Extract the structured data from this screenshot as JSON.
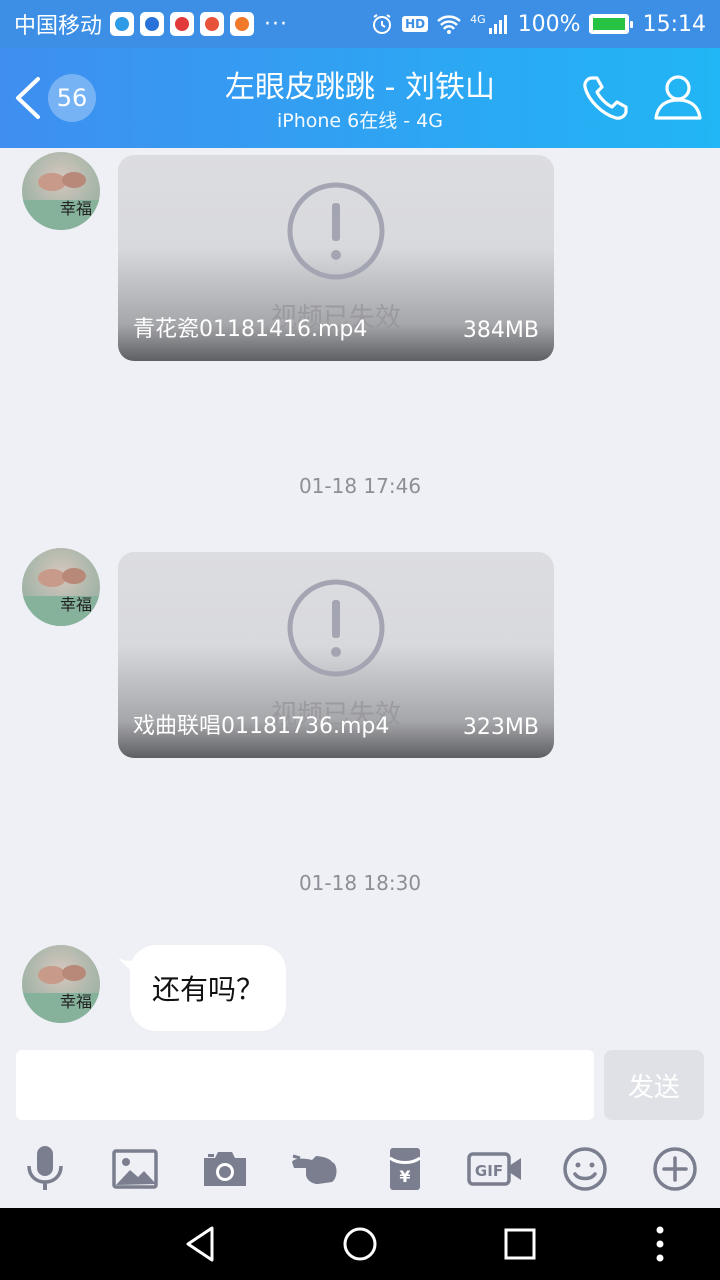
{
  "status_bar": {
    "carrier": "中国移动",
    "dots": "···",
    "hd": "HD",
    "network": "4G",
    "battery": "100%",
    "time": "15:14",
    "app_icon_colors": [
      "#2e9be6",
      "#2a72d8",
      "#e23a3a",
      "#e8523a",
      "#f07a2a"
    ]
  },
  "header": {
    "unread_count": "56",
    "title": "左眼皮跳跳 - 刘铁山",
    "subtitle": "iPhone 6在线 - 4G",
    "call_icon": "phone-icon",
    "profile_icon": "person-icon"
  },
  "messages": [
    {
      "type": "video",
      "filename": "青花瓷01181416.mp4",
      "size": "384MB",
      "overlay": "视频已失效"
    },
    {
      "type": "timestamp",
      "text": "01-18 17:46"
    },
    {
      "type": "video",
      "filename": "戏曲联唱01181736.mp4",
      "size": "323MB",
      "overlay": "视频已失效"
    },
    {
      "type": "timestamp",
      "text": "01-18 18:30"
    },
    {
      "type": "text",
      "text": "还有吗？"
    }
  ],
  "input": {
    "value": "",
    "placeholder": "",
    "send_label": "发送"
  },
  "toolbar": {
    "items": [
      {
        "name": "voice",
        "icon": "microphone-icon"
      },
      {
        "name": "image",
        "icon": "image-icon"
      },
      {
        "name": "camera",
        "icon": "camera-icon"
      },
      {
        "name": "poke",
        "icon": "pointing-hand-icon"
      },
      {
        "name": "red-packet",
        "icon": "red-packet-icon"
      },
      {
        "name": "gif",
        "icon": "gif-icon",
        "label": "GIF"
      },
      {
        "name": "emoji",
        "icon": "emoji-icon"
      },
      {
        "name": "more",
        "icon": "plus-circle-icon"
      }
    ]
  },
  "colors": {
    "header_start": "#3f8ef0",
    "header_end": "#21b6f5",
    "chat_bg": "#eef0f5",
    "icon_gray": "#7b7e8f"
  }
}
